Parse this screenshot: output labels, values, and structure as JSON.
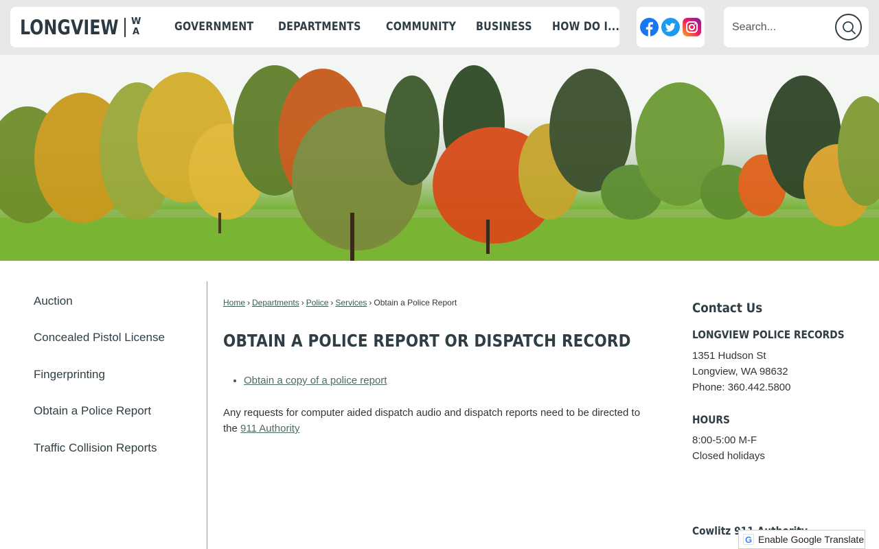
{
  "header": {
    "logo_word": "LONGVIEW",
    "logo_state_1": "W",
    "logo_state_2": "A",
    "nav": [
      {
        "label": "GOVERNMENT"
      },
      {
        "label": "DEPARTMENTS"
      },
      {
        "label": "COMMUNITY"
      },
      {
        "label": "BUSINESS"
      },
      {
        "label": "HOW DO I..."
      }
    ],
    "social": [
      "facebook-icon",
      "twitter-icon",
      "instagram-icon"
    ],
    "search": {
      "placeholder": "Search..."
    }
  },
  "sidebar": {
    "items": [
      {
        "label": "Auction"
      },
      {
        "label": "Concealed Pistol License"
      },
      {
        "label": "Fingerprinting"
      },
      {
        "label": "Obtain a Police Report"
      },
      {
        "label": "Traffic Collision Reports"
      }
    ]
  },
  "main": {
    "breadcrumb": [
      {
        "label": "Home"
      },
      {
        "label": "Departments"
      },
      {
        "label": "Police"
      },
      {
        "label": "Services"
      },
      {
        "label": "Obtain a Police Report"
      }
    ],
    "title": "OBTAIN A POLICE REPORT OR DISPATCH RECORD",
    "bullet_link": "Obtain a copy of a police report",
    "body_prefix": "Any requests for computer aided dispatch audio and dispatch reports need to be directed to the ",
    "body_link": "911 Authority"
  },
  "aside": {
    "title": "Contact Us",
    "records_heading": "LONGVIEW POLICE RECORDS",
    "address1": "1351 Hudson St",
    "address2": "Longview, WA 98632",
    "phone": "Phone: 360.442.5800",
    "hours_heading": "HOURS",
    "hours1": "8:00-5:00 M-F",
    "hours2": "Closed holidays",
    "authority_heading": "Cowlitz 911 Authority"
  },
  "translate": {
    "label": "Enable Google Translate"
  },
  "colors": {
    "text_dark": "#2f3d44",
    "link": "#4d6b62",
    "header_bg": "#e7e9e8"
  }
}
